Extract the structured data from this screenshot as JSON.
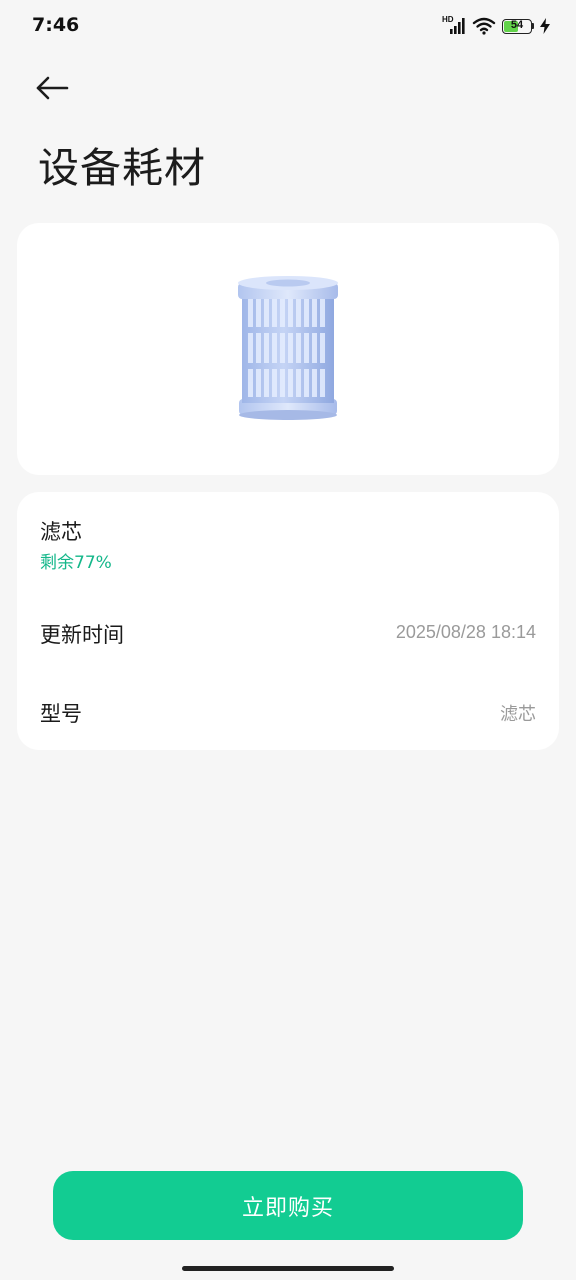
{
  "status_bar": {
    "time": "7:46",
    "network_label": "HD",
    "battery_level": "54",
    "battery_fraction": 0.54,
    "icons": [
      "hd-signal-icon",
      "wifi-icon",
      "battery-icon",
      "charging-icon"
    ]
  },
  "header": {
    "back_icon": "back-arrow-icon",
    "title": "设备耗材"
  },
  "consumable": {
    "image_icon": "filter-cartridge-icon",
    "name": "滤芯",
    "remaining": "剩余77%",
    "remaining_color": "#14b78a"
  },
  "details": {
    "update_time_label": "更新时间",
    "update_time_value": "2025/08/28 18:14",
    "model_label": "型号",
    "model_value": "滤芯"
  },
  "actions": {
    "buy_label": "立即购买",
    "buy_color": "#12cc92"
  },
  "colors": {
    "background": "#f6f6f6",
    "card": "#ffffff",
    "accent": "#12cc92"
  }
}
